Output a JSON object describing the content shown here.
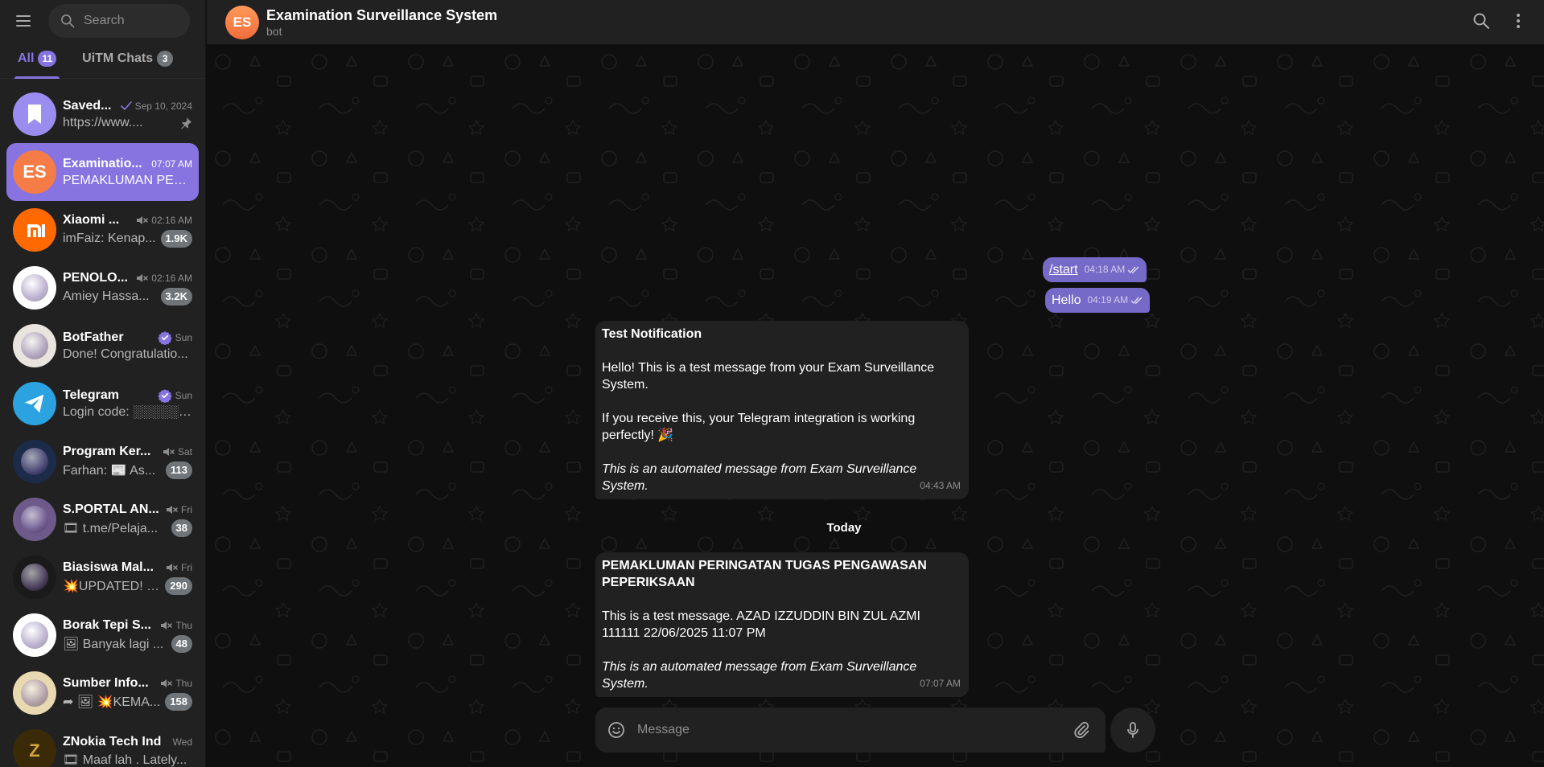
{
  "sidebar": {
    "search_placeholder": "Search",
    "tabs": [
      {
        "label": "All",
        "count": "11",
        "active": true
      },
      {
        "label": "UiTM Chats",
        "count": "3",
        "active": false
      }
    ],
    "chats": [
      {
        "name": "Saved...",
        "time": "Sep 10, 2024",
        "preview": "https://www....",
        "avatar_text": "",
        "avatar_color": "#9b8cf0",
        "unread": "",
        "muted": false,
        "verified": false,
        "pinned": true,
        "read_check": true
      },
      {
        "name": "Examinatio...",
        "time": "07:07 AM",
        "preview": "PEMAKLUMAN PER...",
        "avatar_text": "ES",
        "avatar_color": "#f57c47",
        "unread": "",
        "muted": false,
        "verified": false,
        "pinned": false,
        "read_check": false
      },
      {
        "name": "Xiaomi ...",
        "time": "02:16 AM",
        "preview": "imFaiz: Kenap...",
        "avatar_text": "mi",
        "avatar_color": "#ff6900",
        "unread": "1.9K",
        "muted": true,
        "verified": false,
        "pinned": false,
        "read_check": false
      },
      {
        "name": "PENOLO...",
        "time": "02:16 AM",
        "preview": "Amiey Hassa...",
        "avatar_text": "",
        "avatar_color": "#ffffff",
        "unread": "3.2K",
        "muted": true,
        "verified": false,
        "pinned": false,
        "read_check": false
      },
      {
        "name": "BotFather",
        "time": "Sun",
        "preview": "Done! Congratulatio...",
        "avatar_text": "",
        "avatar_color": "#e9e4dd",
        "unread": "",
        "muted": false,
        "verified": true,
        "pinned": false,
        "read_check": false
      },
      {
        "name": "Telegram",
        "time": "Sun",
        "preview": "Login code: ░░░░░. ...",
        "avatar_text": "",
        "avatar_color": "#2aa3e0",
        "unread": "",
        "muted": false,
        "verified": true,
        "pinned": false,
        "read_check": false
      },
      {
        "name": "Program Ker...",
        "time": "Sat",
        "preview": "Farhan: 📰 As...",
        "avatar_text": "",
        "avatar_color": "#1c2b4a",
        "unread": "113",
        "muted": true,
        "verified": false,
        "pinned": false,
        "read_check": false
      },
      {
        "name": "S.PORTAL AN...",
        "time": "Fri",
        "preview": "🎞 t.me/Pelaja...",
        "avatar_text": "",
        "avatar_color": "#6e5a8a",
        "unread": "38",
        "muted": true,
        "verified": false,
        "pinned": false,
        "read_check": false
      },
      {
        "name": "Biasiswa Mal...",
        "time": "Fri",
        "preview": "💥UPDATED! S...",
        "avatar_text": "",
        "avatar_color": "#1a1a1a",
        "unread": "290",
        "muted": true,
        "verified": false,
        "pinned": false,
        "read_check": false
      },
      {
        "name": "Borak Tepi S...",
        "time": "Thu",
        "preview": "🖼 Banyak lagi ...",
        "avatar_text": "",
        "avatar_color": "#ffffff",
        "unread": "48",
        "muted": true,
        "verified": false,
        "pinned": false,
        "read_check": false
      },
      {
        "name": "Sumber Info...",
        "time": "Thu",
        "preview": "➦ 🖼 💥KEMA...",
        "avatar_text": "",
        "avatar_color": "#e8d9b0",
        "unread": "158",
        "muted": true,
        "verified": false,
        "pinned": false,
        "read_check": false
      },
      {
        "name": "ZNokia Tech Ind",
        "time": "Wed",
        "preview": "🎞 Maaf lah . Lately...",
        "avatar_text": "Z",
        "avatar_color": "#3a2a08",
        "unread": "",
        "muted": false,
        "verified": false,
        "pinned": false,
        "read_check": false
      }
    ]
  },
  "header": {
    "avatar_text": "ES",
    "title": "Examination Surveillance System",
    "status": "bot"
  },
  "messages": {
    "out1": {
      "text": "/start",
      "time": "04:18 AM"
    },
    "out2": {
      "text": "Hello",
      "time": "04:19 AM"
    },
    "in1": {
      "title": "Test Notification",
      "line1": "Hello! This is a test message from your Exam Surveillance System.",
      "line2": "If you receive this, your Telegram integration is working perfectly! 🎉",
      "footer": "This is an automated message from Exam Surveillance System.",
      "time": "04:43 AM"
    },
    "date_separator": "Today",
    "in2": {
      "title": "PEMAKLUMAN PERINGATAN TUGAS PENGAWASAN PEPERIKSAAN",
      "line1": "This is a test message. AZAD IZZUDDIN BIN ZUL AZMI 111111 22/06/2025 11:07 PM",
      "footer": "This is an automated message from Exam Surveillance System.",
      "time": "07:07 AM"
    }
  },
  "composer": {
    "placeholder": "Message"
  },
  "colors": {
    "accent": "#8774e1",
    "outgoing_bubble": "#766ac8",
    "incoming_bubble": "#212121",
    "background": "#0f0f0f"
  }
}
